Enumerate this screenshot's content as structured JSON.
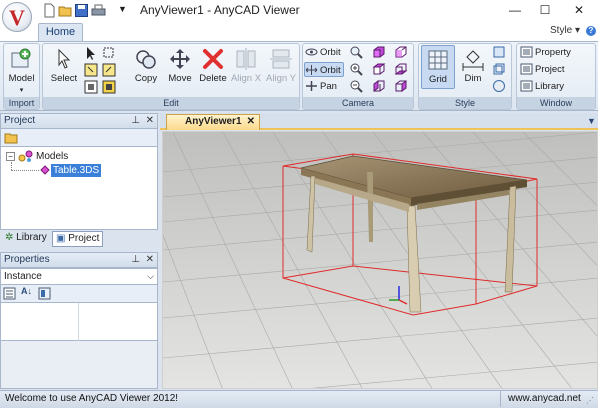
{
  "window": {
    "title": "AnyViewer1 - AnyCAD Viewer",
    "logo_letter": "V",
    "minimize": "—",
    "maximize": "☐",
    "close": "✕"
  },
  "ribbon": {
    "tabs": [
      {
        "label": "Home"
      }
    ],
    "style_menu": "Style",
    "groups": {
      "import": {
        "label": "Import",
        "model": "Model"
      },
      "edit": {
        "label": "Edit",
        "select": "Select",
        "copy": "Copy",
        "move": "Move",
        "delete": "Delete",
        "align_x": "Align X",
        "align_y": "Align Y"
      },
      "camera": {
        "label": "Camera",
        "orbit1": "Orbit",
        "orbit2": "Orbit",
        "pan": "Pan"
      },
      "style": {
        "label": "Style",
        "grid": "Grid",
        "dim": "Dim"
      },
      "window": {
        "label": "Window",
        "property": "Property",
        "project": "Project",
        "library": "Library"
      }
    }
  },
  "project_panel": {
    "title": "Project",
    "tree": {
      "root": "Models",
      "child": "Table.3DS"
    },
    "tabs": [
      {
        "label": "Library"
      },
      {
        "label": "Project"
      }
    ]
  },
  "properties_panel": {
    "title": "Properties",
    "selected": "Instance"
  },
  "document": {
    "tab_label": "AnyViewer1"
  },
  "status": {
    "message": "Welcome to use AnyCAD Viewer 2012!",
    "url": "www.anycad.net"
  },
  "colors": {
    "accent": "#f0c35a",
    "selection_box": "#e02a2a"
  }
}
